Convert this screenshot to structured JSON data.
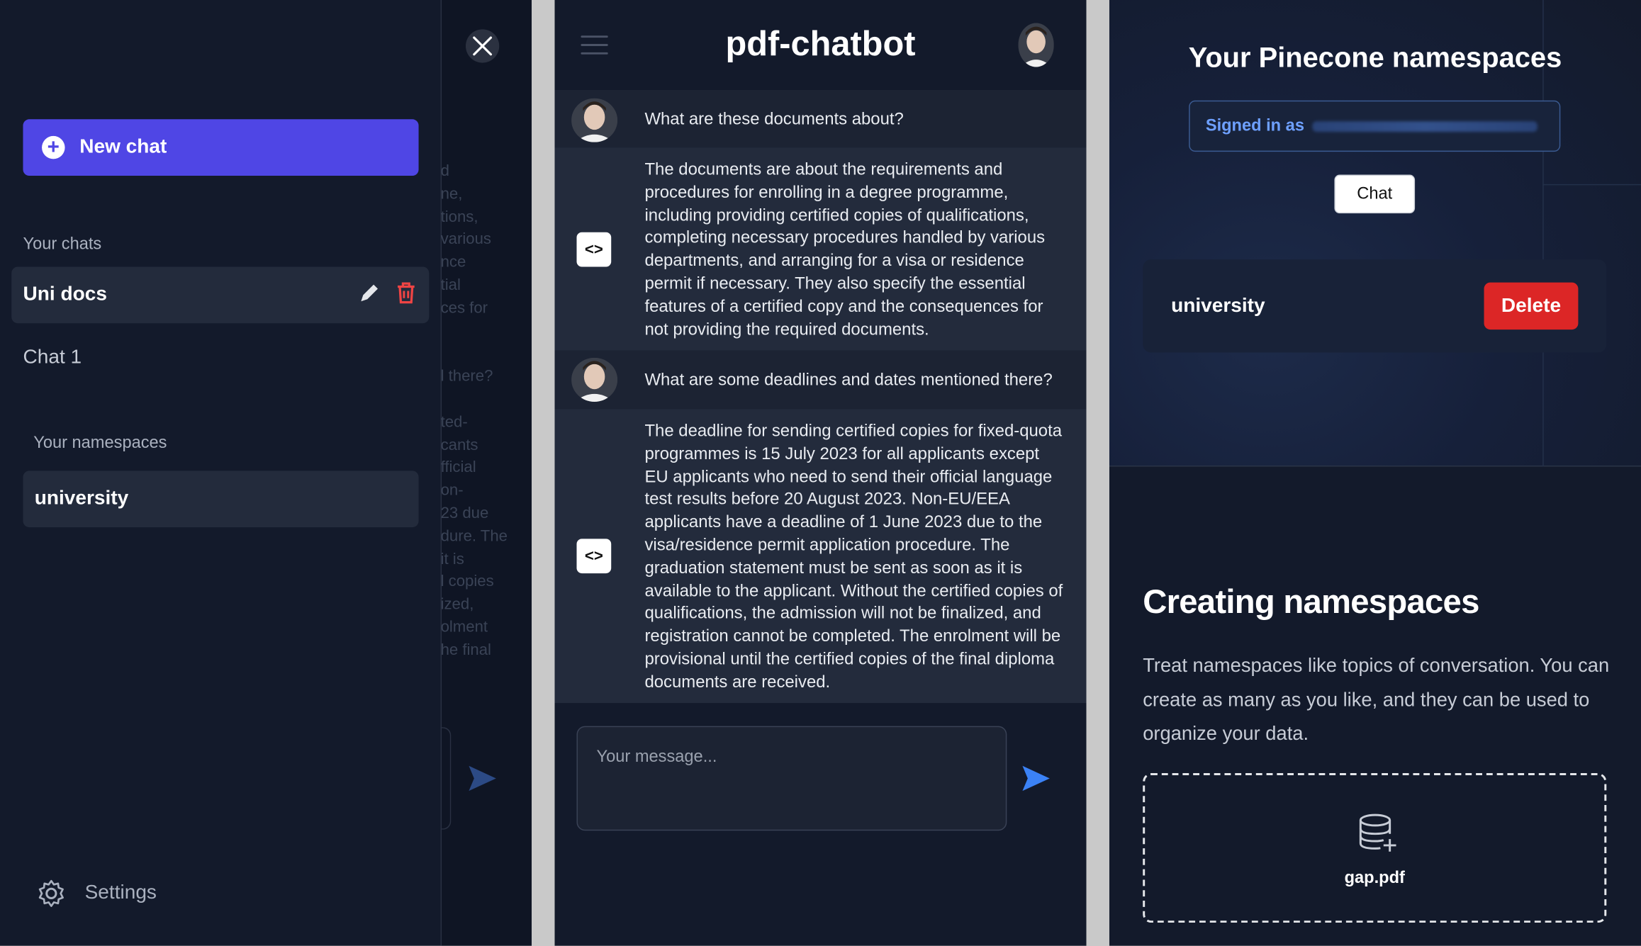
{
  "sidebar": {
    "new_chat_label": "New chat",
    "chats_heading": "Your chats",
    "chats": [
      {
        "label": "Uni docs",
        "active": true
      },
      {
        "label": "Chat 1",
        "active": false
      }
    ],
    "namespaces_heading": "Your namespaces",
    "namespaces": [
      "university"
    ],
    "settings_label": "Settings",
    "background_fragments": [
      "d",
      "ne,",
      "tions,",
      "various",
      "nce",
      "tial",
      "ces for",
      "",
      "",
      "l there?",
      "",
      "ted-",
      "cants",
      "fficial",
      "on-",
      "23 due",
      "dure. The",
      "it is",
      "l copies",
      "ized,",
      "olment",
      "he final"
    ]
  },
  "chat": {
    "title": "pdf-chatbot",
    "messages": [
      {
        "role": "user",
        "text": "What are these documents about?"
      },
      {
        "role": "bot",
        "text": "The documents are about the requirements and procedures for enrolling in a degree programme, including providing certified copies of qualifications, completing necessary procedures handled by various departments, and arranging for a visa or residence permit if necessary. They also specify the essential features of a certified copy and the consequences for not providing the required documents."
      },
      {
        "role": "user",
        "text": "What are some deadlines and dates mentioned there?"
      },
      {
        "role": "bot",
        "text": "The deadline for sending certified copies for fixed-quota programmes is 15 July 2023 for all applicants except EU applicants who need to send their official language test results before 20 August 2023. Non-EU/EEA applicants have a deadline of 1 June 2023 due to the visa/residence permit application procedure. The graduation statement must be sent as soon as it is available to the applicant. Without the certified copies of qualifications, the admission will not be finalized, and registration cannot be completed. The enrolment will be provisional until the certified copies of the final diploma documents are received."
      }
    ],
    "input_placeholder": "Your message...",
    "bot_icon_glyph": "<>"
  },
  "namespaces_page": {
    "heading": "Your Pinecone namespaces",
    "signed_in_label": "Signed in as",
    "chat_button": "Chat",
    "namespace_name": "university",
    "delete_button": "Delete",
    "creating_heading": "Creating namespaces",
    "creating_desc": "Treat namespaces like topics of conversation. You can create as many as you like, and they can be used to organize your data.",
    "file_name": "gap.pdf"
  },
  "colors": {
    "background": "#131a2b",
    "accent": "#4f46e5",
    "danger": "#dc2626",
    "send": "#3b82f6",
    "link": "#6ea0ff"
  },
  "icons": [
    "close-icon",
    "plus-icon",
    "edit-icon",
    "trash-icon",
    "gear-icon",
    "menu-icon",
    "send-icon",
    "code-icon",
    "database-add-icon",
    "avatar"
  ]
}
